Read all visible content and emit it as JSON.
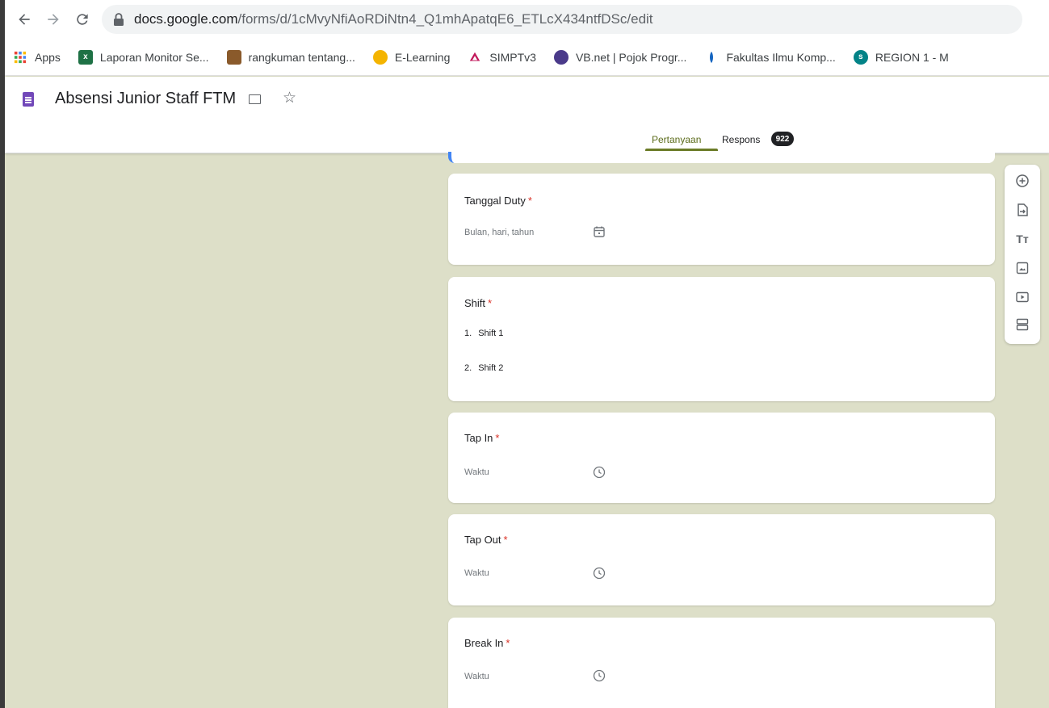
{
  "browser": {
    "url_host": "docs.google.com",
    "url_path": "/forms/d/1cMvyNfiAoRDiNtn4_Q1mhApatqE6_ETLcX434ntfDSc/edit"
  },
  "bookmarks": [
    {
      "label": "Apps",
      "icon": "apps-grid-icon",
      "color": "#e8453c"
    },
    {
      "label": "Laporan Monitor Se...",
      "icon": "excel-icon",
      "color": "#1e7145"
    },
    {
      "label": "rangkuman tentang...",
      "icon": "image-thumbnail-icon",
      "color": "#8a5a2b"
    },
    {
      "label": "E-Learning",
      "icon": "elearning-logo-icon",
      "color": "#f4b400"
    },
    {
      "label": "SIMPTv3",
      "icon": "simpt-logo-icon",
      "color": "#c2185b"
    },
    {
      "label": "VB.net | Pojok Progr...",
      "icon": "vbnet-logo-icon",
      "color": "#4a3a8a"
    },
    {
      "label": "Fakultas Ilmu Komp...",
      "icon": "faculty-logo-icon",
      "color": "#1565c0"
    },
    {
      "label": "REGION 1 - M",
      "icon": "sharepoint-icon",
      "color": "#038387"
    }
  ],
  "header": {
    "title": "Absensi Junior Staff FTM",
    "tabs": {
      "questions": "Pertanyaan",
      "responses": "Respons"
    },
    "response_count": "922"
  },
  "questions": [
    {
      "title": "Tanggal Duty",
      "required": "*",
      "hint": "Bulan, hari, tahun",
      "icon": "calendar-icon"
    },
    {
      "title": "Shift",
      "required": "*",
      "options": [
        {
          "num": "1.",
          "label": "Shift 1"
        },
        {
          "num": "2.",
          "label": "Shift 2"
        }
      ]
    },
    {
      "title": "Tap In",
      "required": "*",
      "hint": "Waktu",
      "icon": "clock-icon"
    },
    {
      "title": "Tap Out",
      "required": "*",
      "hint": "Waktu",
      "icon": "clock-icon"
    },
    {
      "title": "Break In",
      "required": "*",
      "hint": "Waktu",
      "icon": "clock-icon"
    }
  ],
  "colors": {
    "accent": "#6b7b27",
    "background": "#dddfc8",
    "required": "#d93025",
    "forms_purple": "#7248b9"
  }
}
